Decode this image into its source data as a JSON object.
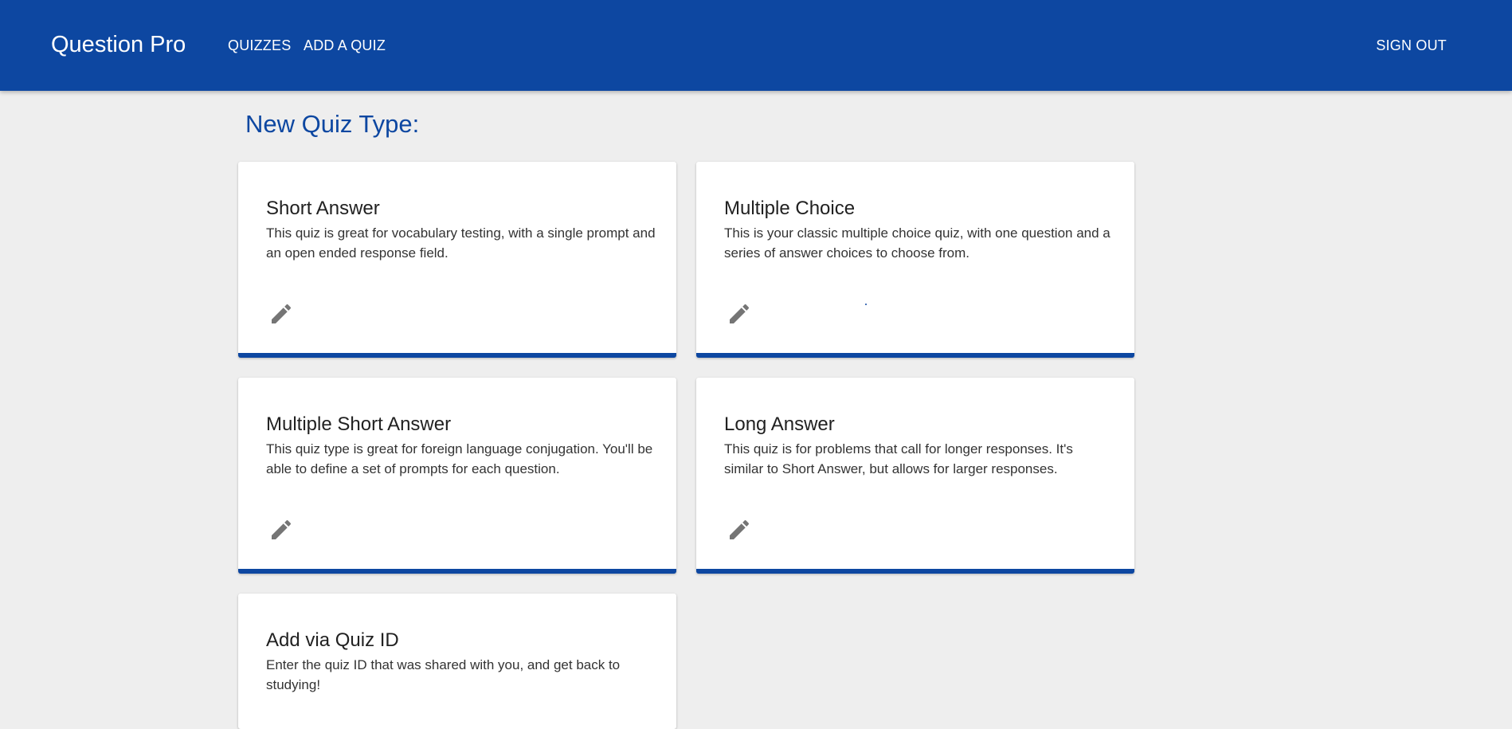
{
  "nav": {
    "brand": "Question Pro",
    "links": [
      "QUIZZES",
      "ADD A QUIZ"
    ],
    "sign_out": "SIGN OUT"
  },
  "heading": "New Quiz Type:",
  "cards": [
    {
      "title": "Short Answer",
      "description": "This quiz is great for vocabulary testing, with a single prompt and an open ended response field.",
      "action_icon": "pencil-icon"
    },
    {
      "title": "Multiple Choice",
      "description": "This is your classic multiple choice quiz, with one question and a series of answer choices to choose from.",
      "action_icon": "pencil-icon"
    },
    {
      "title": "Multiple Short Answer",
      "description": "This quiz type is great for foreign language conjugation. You'll be able to define a set of prompts for each question.",
      "action_icon": "pencil-icon"
    },
    {
      "title": "Long Answer",
      "description": "This quiz is for problems that call for longer responses. It's similar to Short Answer, but allows for larger responses.",
      "action_icon": "pencil-icon"
    },
    {
      "title": "Add via Quiz ID",
      "description": "Enter the quiz ID that was shared with you, and get back to studying!"
    }
  ],
  "colors": {
    "primary": "#0d47a1",
    "background": "#eeeeee",
    "card": "#ffffff",
    "icon": "#757575"
  }
}
